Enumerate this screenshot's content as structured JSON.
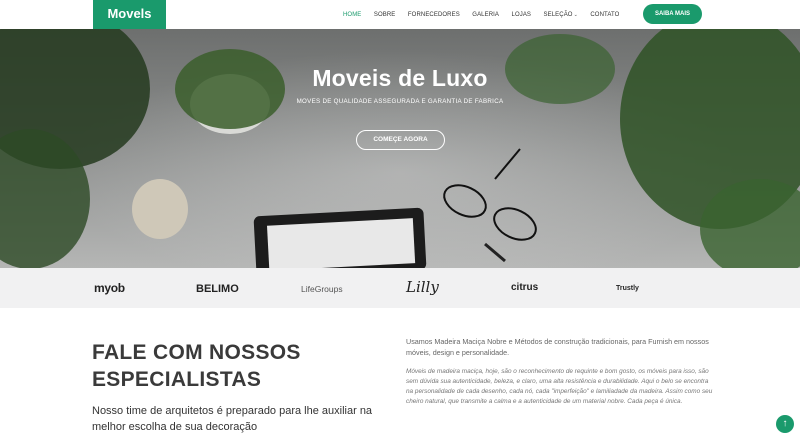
{
  "header": {
    "logo": "Movels",
    "menu": [
      {
        "label": "HOME",
        "active": true
      },
      {
        "label": "SOBRE"
      },
      {
        "label": "FORNECEDORES"
      },
      {
        "label": "GALERIA"
      },
      {
        "label": "LOJAS"
      },
      {
        "label": "SELEÇÃO"
      },
      {
        "label": "CONTATO"
      }
    ],
    "cta": "SAIBA MAIS"
  },
  "hero": {
    "title": "Moveis de Luxo",
    "subtitle": "MOVES DE QUALIDADE ASSEGURADA E GARANTIA DE FABRICA",
    "button": "COMEÇE AGORA"
  },
  "brands": [
    "myob",
    "BELIMO",
    "LifeGroups",
    "Lilly",
    "citrus",
    "Trustly"
  ],
  "content": {
    "heading": "FALE COM NOSSOS ESPECIALISTAS",
    "lead": "Nosso time de arquitetos é preparado para lhe auxiliar na melhor escolha de sua decoração",
    "paragraph1": "Usamos Madeira Maciça Nobre e Métodos de construção tradicionais, para Furnish em nossos móveis, design e personalidade.",
    "paragraph2": "Móveis de madeira maciça, hoje, são o reconhecimento de requinte e bom gosto, os móveis para isso, são sem dúvida sua autenticidade, beleza, e claro, uma alta resistência e durabilidade. Aqui o belo se encontra na personalidade de cada desenho, cada nó, cada \"imperfeição\" e lamiliadade da madeira. Assim como seu cheiro natural, que transmite a calma e a autenticidade de um material nobre. Cada peça é única."
  },
  "colors": {
    "accent": "#1a9a6c"
  }
}
